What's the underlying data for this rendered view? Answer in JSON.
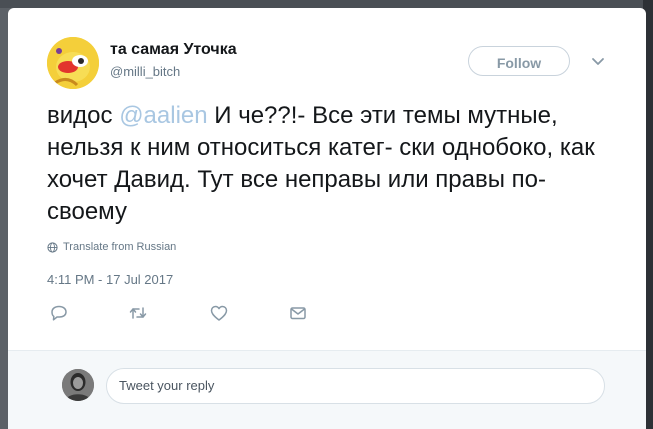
{
  "tweet": {
    "display_name": "та самая Уточка",
    "handle": "@milli_bitch",
    "follow_label": "Follow",
    "text_prefix": "видос ",
    "mention": "@aalien",
    "text_body": " И че??!- Все эти темы мутные, нельзя к ним относиться катег- ски однобоко, как хочет Давид. Тут все неправы или правы по-своему",
    "translate_label": "Translate from Russian",
    "timestamp": "4:11 PM - 17 Jul 2017",
    "actions": [
      {
        "name": "reply",
        "icon": "reply-icon"
      },
      {
        "name": "retweet",
        "icon": "retweet-icon"
      },
      {
        "name": "like",
        "icon": "heart-icon"
      },
      {
        "name": "direct-message",
        "icon": "envelope-icon"
      }
    ]
  },
  "reply": {
    "placeholder": "Tweet your reply"
  },
  "colors": {
    "text": "#14171a",
    "secondary": "#657786",
    "mention": "#a9c7e2",
    "follow_border": "#c9d3dc",
    "reply_bg": "#f5f8fa"
  }
}
